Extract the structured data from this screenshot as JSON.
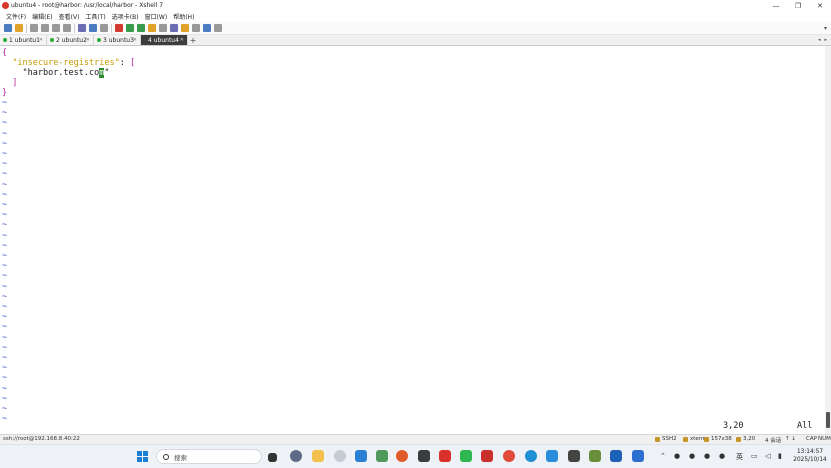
{
  "window": {
    "title": "ubuntu4 - root@harbor: /usr/local/harbor - Xshell 7",
    "controls": [
      "—",
      "❐",
      "✕"
    ]
  },
  "menu": [
    "文件(F)",
    "编辑(E)",
    "查看(V)",
    "工具(T)",
    "选项卡(B)",
    "窗口(W)",
    "帮助(H)"
  ],
  "tabs": [
    {
      "label": "1 ubuntu1",
      "active": false
    },
    {
      "label": "2 ubuntu2",
      "active": false
    },
    {
      "label": "3 ubuntu3",
      "active": false
    },
    {
      "label": "4 ubuntu4",
      "active": true
    }
  ],
  "terminal": {
    "open_brace": "{",
    "key": "\"insecure-registries\"",
    "colon": ": ",
    "open_bracket": "[",
    "value_before_cursor": "\"harbor.test.co",
    "value_cursor": "m",
    "value_after_cursor": "\"",
    "close_bracket": "]",
    "close_brace": "}",
    "tilde": "~",
    "cursor_pos": "3,20",
    "scope": "All"
  },
  "status": {
    "connection": "ssh://root@192.168.8.40:22",
    "protocol": "SSH2",
    "term": "xterm",
    "size": "157x38",
    "cursor": "3,20",
    "sessions": "4 会话",
    "caps": "CAP",
    "num": "NUM"
  },
  "taskbar": {
    "search_placeholder": "搜索",
    "lang": "英",
    "time": "13:14:57",
    "date": "2025/10/14"
  }
}
